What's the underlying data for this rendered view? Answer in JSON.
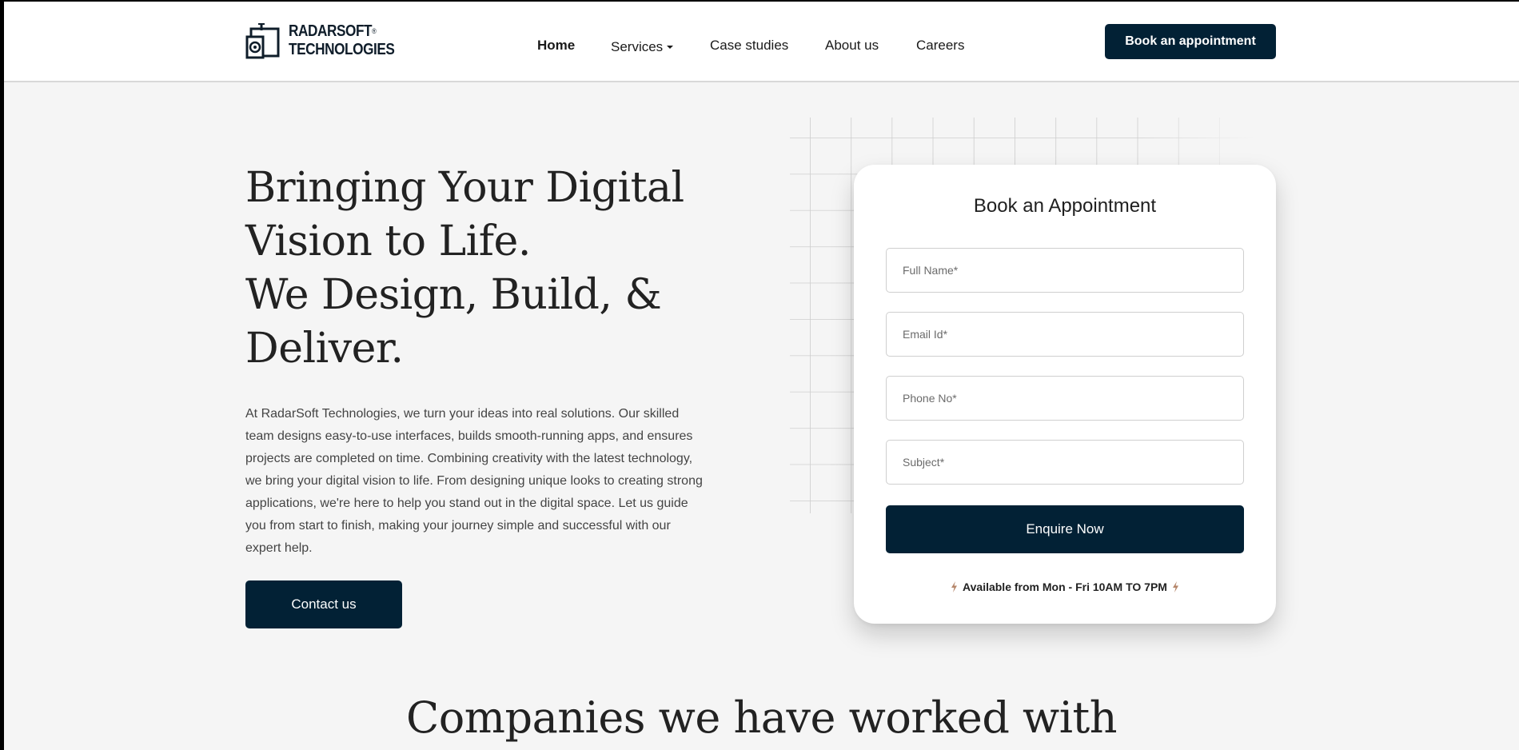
{
  "brand": {
    "line1": "RADARSOFT",
    "line2": "TECHNOLOGIES",
    "mark": "®"
  },
  "nav": {
    "items": [
      {
        "label": "Home"
      },
      {
        "label": "Services"
      },
      {
        "label": "Case studies"
      },
      {
        "label": "About us"
      },
      {
        "label": "Careers"
      }
    ],
    "cta_label": "Book an appointment"
  },
  "hero": {
    "title_lines": [
      "Bringing Your Digital",
      "Vision to Life.",
      "We Design, Build, &",
      "Deliver."
    ],
    "description": "At RadarSoft Technologies, we turn your ideas into real solutions. Our skilled team designs easy-to-use interfaces, builds smooth-running apps, and ensures projects are completed on time. Combining creativity with the latest technology, we bring your digital vision to life. From designing unique looks to creating strong applications, we're here to help you stand out in the digital space. Let us guide you from start to finish, making your journey simple and successful with our expert help.",
    "contact_label": "Contact us"
  },
  "appointment": {
    "title": "Book an Appointment",
    "fields": {
      "name_placeholder": "Full Name*",
      "email_placeholder": "Email Id*",
      "phone_placeholder": "Phone No*",
      "subject_placeholder": "Subject*"
    },
    "submit_label": "Enquire Now",
    "availability": "Available from Mon - Fri 10AM TO 7PM",
    "icon": "lightning-bolt-icon"
  },
  "companies": {
    "title": "Companies we have worked with"
  },
  "colors": {
    "primary": "#022135",
    "page_bg": "#f5f5f5",
    "accent_bolt": "#b5866a"
  }
}
